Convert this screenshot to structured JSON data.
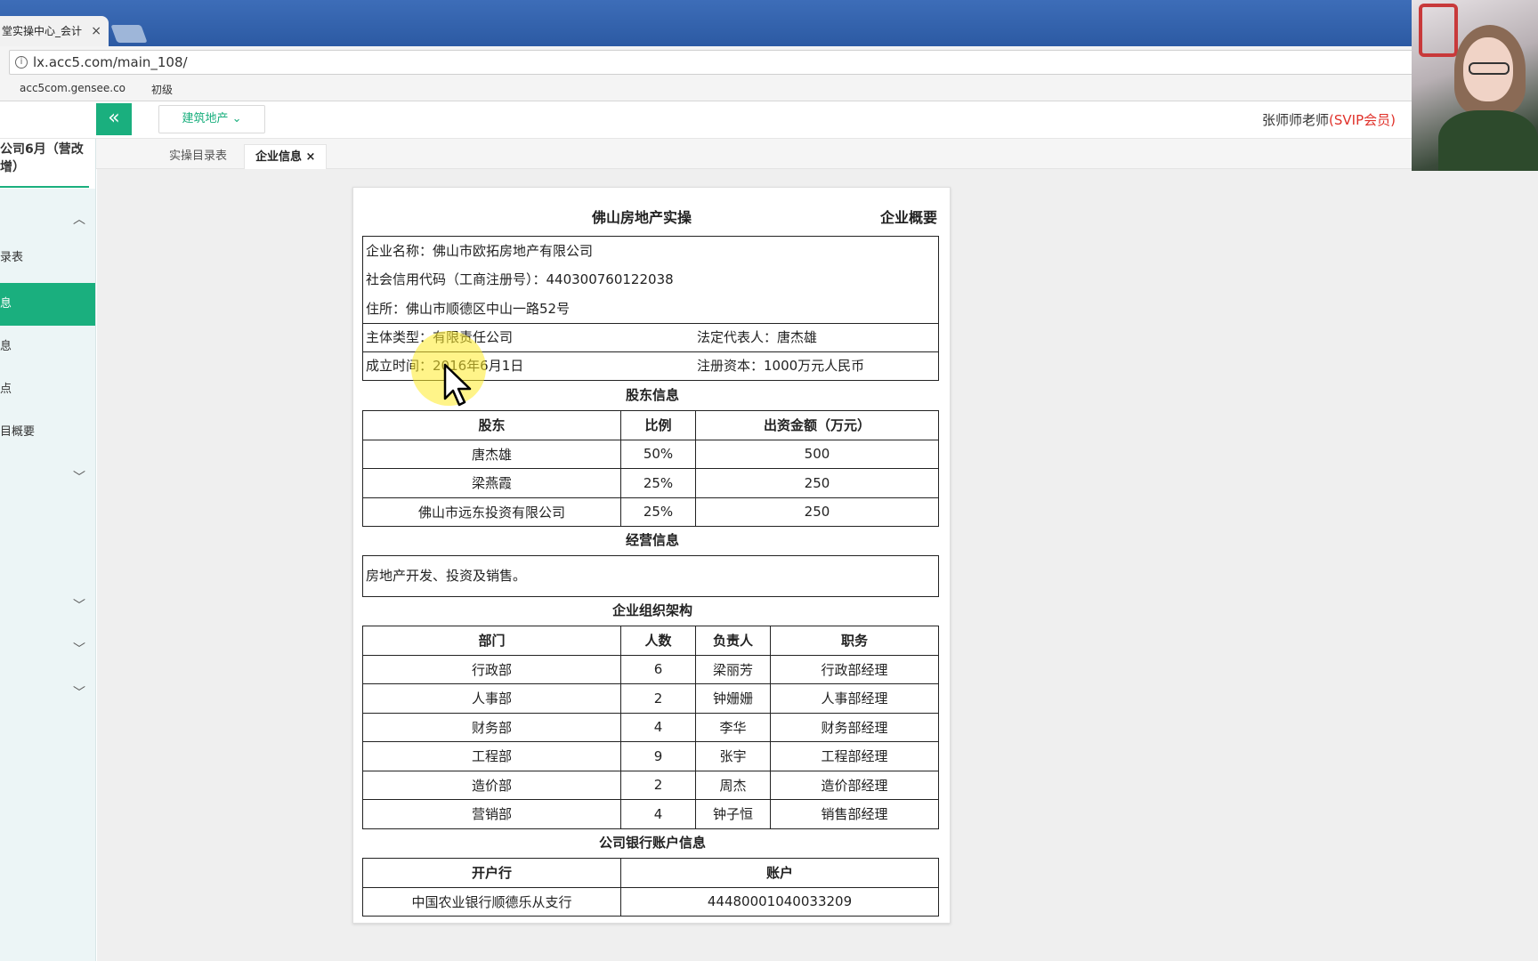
{
  "browser": {
    "tab_title": "堂实操中心_会计",
    "tab_close": "×",
    "url": "lx.acc5.com/main_108/",
    "bookmarks": [
      "acc5com.gensee.co",
      "初级"
    ]
  },
  "header": {
    "collapse": "«",
    "industry": "建筑地产 ⌄",
    "user_name": "张师师老师",
    "user_badge": "(SVIP会员)"
  },
  "sidebar": {
    "company_line1": "公司6月（营改",
    "company_line2": "增）",
    "items": [
      "录表",
      "息",
      "息",
      "点",
      "目概要"
    ]
  },
  "tabs": [
    {
      "label": "实操目录表"
    },
    {
      "label": "企业信息",
      "close": "×"
    }
  ],
  "doc": {
    "title": "佛山房地产实操",
    "subtitle": "企业概要",
    "company_name": "企业名称：佛山市欧拓房地产有限公司",
    "credit_code": "社会信用代码（工商注册号）：440300760122038",
    "address": "住所：佛山市顺德区中山一路52号",
    "entity_type": "主体类型：有限责任公司",
    "legal_rep": "法定代表人：唐杰雄",
    "founded": "成立时间：2016年6月1日",
    "capital": "注册资本：1000万元人民币",
    "shareholders_title": "股东信息",
    "shareholders_headers": [
      "股东",
      "比例",
      "出资金额（万元）"
    ],
    "shareholders": [
      [
        "唐杰雄",
        "50%",
        "500"
      ],
      [
        "梁燕霞",
        "25%",
        "250"
      ],
      [
        "佛山市远东投资有限公司",
        "25%",
        "250"
      ]
    ],
    "business_title": "经营信息",
    "business_scope": "房地产开发、投资及销售。",
    "org_title": "企业组织架构",
    "org_headers": [
      "部门",
      "人数",
      "负责人",
      "职务"
    ],
    "org": [
      [
        "行政部",
        "6",
        "梁丽芳",
        "行政部经理"
      ],
      [
        "人事部",
        "2",
        "钟姗姗",
        "人事部经理"
      ],
      [
        "财务部",
        "4",
        "李华",
        "财务部经理"
      ],
      [
        "工程部",
        "9",
        "张宇",
        "工程部经理"
      ],
      [
        "造价部",
        "2",
        "周杰",
        "造价部经理"
      ],
      [
        "营销部",
        "4",
        "钟子恒",
        "销售部经理"
      ]
    ],
    "bank_title": "公司银行账户信息",
    "bank_headers": [
      "开户行",
      "账户"
    ],
    "bank": [
      [
        "中国农业银行顺德乐从支行",
        "44480001040033209"
      ]
    ]
  }
}
